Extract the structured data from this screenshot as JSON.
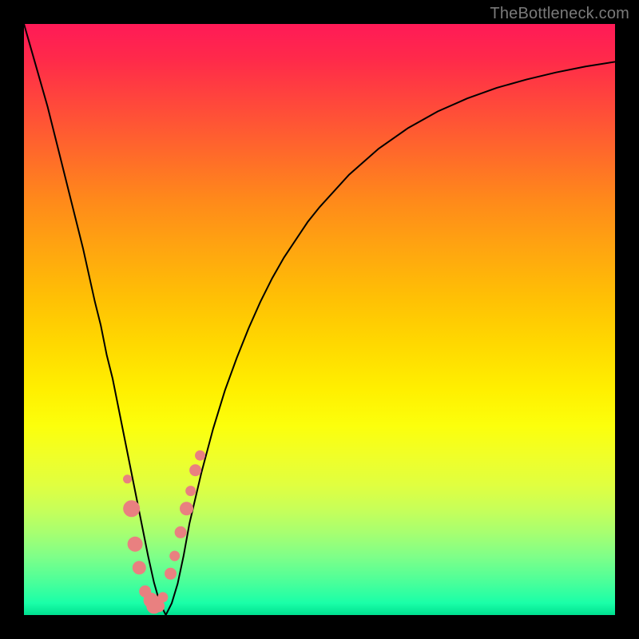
{
  "watermark": "TheBottleneck.com",
  "colors": {
    "curve_stroke": "#000000",
    "marker_fill": "#e98080",
    "marker_stroke": "#e98080",
    "background_frame": "#000000"
  },
  "chart_data": {
    "type": "line",
    "title": "",
    "xlabel": "",
    "ylabel": "",
    "xlim": [
      0,
      100
    ],
    "ylim": [
      0,
      100
    ],
    "grid": false,
    "legend": false,
    "x": [
      0,
      2,
      4,
      6,
      8,
      10,
      12,
      13,
      14,
      15,
      16,
      17,
      18,
      19,
      20,
      21,
      22,
      23,
      24,
      25,
      26,
      27,
      28,
      30,
      32,
      34,
      36,
      38,
      40,
      42,
      44,
      46,
      48,
      50,
      55,
      60,
      65,
      70,
      75,
      80,
      85,
      90,
      95,
      100
    ],
    "values": [
      100,
      93,
      86,
      78,
      70,
      62,
      53,
      49,
      44,
      40,
      35,
      30,
      25,
      20,
      15,
      10,
      5.5,
      2,
      0,
      2,
      5.3,
      10,
      15.5,
      24,
      31.5,
      38,
      43.5,
      48.5,
      53,
      57,
      60.5,
      63.5,
      66.5,
      69,
      74.5,
      78.9,
      82.4,
      85.2,
      87.4,
      89.2,
      90.6,
      91.8,
      92.8,
      93.6
    ],
    "markers": {
      "x": [
        17.5,
        18.2,
        18.8,
        19.5,
        20.5,
        21.5,
        22.0,
        22.8,
        23.5,
        24.8,
        25.5,
        26.5,
        27.5,
        28.2,
        29.0,
        29.8
      ],
      "y": [
        23,
        18,
        12,
        8,
        4,
        2.5,
        1.5,
        1.5,
        3,
        7,
        10,
        14,
        18,
        21,
        24.5,
        27
      ],
      "r": [
        5,
        10,
        9,
        8,
        7,
        9,
        9,
        7,
        6,
        7,
        6,
        7,
        8,
        6,
        7,
        6
      ]
    }
  }
}
